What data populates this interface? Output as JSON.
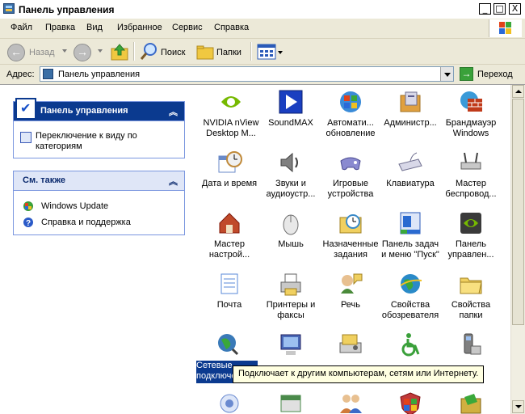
{
  "window": {
    "title": "Панель управления"
  },
  "titlebar_buttons": {
    "minimize": "_",
    "maximize": "□",
    "close": "X"
  },
  "menu": [
    {
      "label": "Файл"
    },
    {
      "label": "Правка"
    },
    {
      "label": "Вид"
    },
    {
      "label": "Избранное"
    },
    {
      "label": "Сервис"
    },
    {
      "label": "Справка"
    }
  ],
  "toolbar": {
    "back_label": "Назад",
    "search_label": "Поиск",
    "folders_label": "Папки"
  },
  "address": {
    "label": "Адрес:",
    "value": "Панель управления",
    "go_label": "Переход"
  },
  "left_pane": {
    "control_panel": {
      "title": "Панель управления",
      "link": "Переключение к виду по категориям"
    },
    "see_also": {
      "title": "См. также",
      "links": [
        {
          "label": "Windows Update",
          "icon": "windows-update-icon"
        },
        {
          "label": "Справка и поддержка",
          "icon": "help-icon"
        }
      ]
    }
  },
  "items": [
    {
      "label": "NVIDIA nView Desktop M...",
      "icon": "nvidia-icon",
      "color": "#76b900"
    },
    {
      "label": "SoundMAX",
      "icon": "soundmax-icon",
      "color": "#1a3fc0"
    },
    {
      "label": "Автомати... обновление",
      "icon": "auto-update-icon",
      "color": "#3a8bd8"
    },
    {
      "label": "Администр...",
      "icon": "admin-tools-icon",
      "color": "#e0a040"
    },
    {
      "label": "Брандмауэр Windows",
      "icon": "firewall-icon",
      "color": "#c03a1a"
    },
    {
      "label": "Дата и время",
      "icon": "date-time-icon",
      "color": "#6a8ac8"
    },
    {
      "label": "Звуки и аудиоустр...",
      "icon": "sound-icon",
      "color": "#808080"
    },
    {
      "label": "Игровые устройства",
      "icon": "game-controller-icon",
      "color": "#8a8ad0"
    },
    {
      "label": "Клавиатура",
      "icon": "keyboard-icon",
      "color": "#a0a0b0"
    },
    {
      "label": "Мастер беспровод...",
      "icon": "wireless-wizard-icon",
      "color": "#909090"
    },
    {
      "label": "Мастер настрой...",
      "icon": "network-setup-icon",
      "color": "#c04a2a"
    },
    {
      "label": "Мышь",
      "icon": "mouse-icon",
      "color": "#c8c8c8"
    },
    {
      "label": "Назначенные задания",
      "icon": "scheduled-tasks-icon",
      "color": "#e8c040"
    },
    {
      "label": "Панель задач и меню \"Пуск\"",
      "icon": "taskbar-icon",
      "color": "#2a6ad0"
    },
    {
      "label": "Панель управлен...",
      "icon": "nvidia-panel-icon",
      "color": "#3a3a3a"
    },
    {
      "label": "Почта",
      "icon": "mail-icon",
      "color": "#5a8ad8"
    },
    {
      "label": "Принтеры и факсы",
      "icon": "printers-icon",
      "color": "#d0c040"
    },
    {
      "label": "Речь",
      "icon": "speech-icon",
      "color": "#4a8a3a"
    },
    {
      "label": "Свойства обозревателя",
      "icon": "internet-options-icon",
      "color": "#2a8ac8"
    },
    {
      "label": "Свойства папки",
      "icon": "folder-options-icon",
      "color": "#f0d060"
    },
    {
      "label": "Сетевые подключения",
      "icon": "network-connections-icon",
      "color": "#3a7ab8"
    },
    {
      "label": "",
      "icon": "system-icon",
      "color": "#4a6ab8"
    },
    {
      "label": "",
      "icon": "scanners-icon",
      "color": "#909090"
    },
    {
      "label": "",
      "icon": "accessibility-icon",
      "color": "#3aa03a"
    },
    {
      "label": "",
      "icon": "phone-modem-icon",
      "color": "#808080"
    },
    {
      "label": "",
      "icon": "display-icon",
      "color": "#6a8ad0"
    },
    {
      "label": "",
      "icon": "fonts-icon",
      "color": "#4a8a4a"
    },
    {
      "label": "",
      "icon": "user-accounts-icon",
      "color": "#d07a3a"
    },
    {
      "label": "",
      "icon": "security-center-icon",
      "color": "#c03a3a"
    },
    {
      "label": "",
      "icon": "add-remove-icon",
      "color": "#d0b040"
    }
  ],
  "tooltip": {
    "text": "Подключает к другим компьютерам, сетям или Интернету."
  }
}
